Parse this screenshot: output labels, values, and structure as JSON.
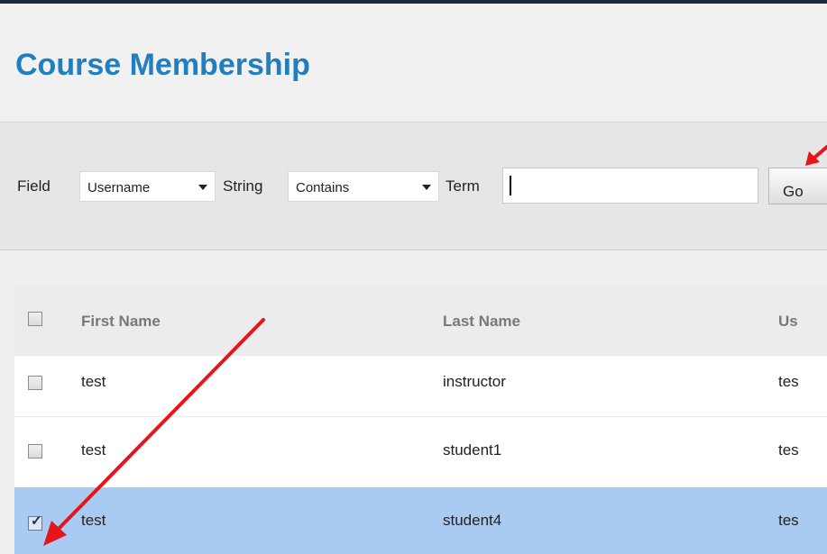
{
  "page": {
    "title": "Course Membership"
  },
  "search": {
    "field_label": "Field",
    "field_value": "Username",
    "string_label": "String",
    "string_value": "Contains",
    "term_label": "Term",
    "term_value": "",
    "go_label": "Go"
  },
  "table": {
    "columns": [
      "First Name",
      "Last Name",
      "Us"
    ],
    "rows": [
      {
        "first": "test",
        "last": "instructor",
        "user": "tes",
        "checked": false
      },
      {
        "first": "test",
        "last": "student1",
        "user": "tes",
        "checked": false
      },
      {
        "first": "test",
        "last": "student4",
        "user": "tes",
        "checked": true
      }
    ]
  },
  "colors": {
    "title": "#1f7fbf",
    "selected_row": "#a9cbf2",
    "annotation_arrow": "#e8141b"
  }
}
